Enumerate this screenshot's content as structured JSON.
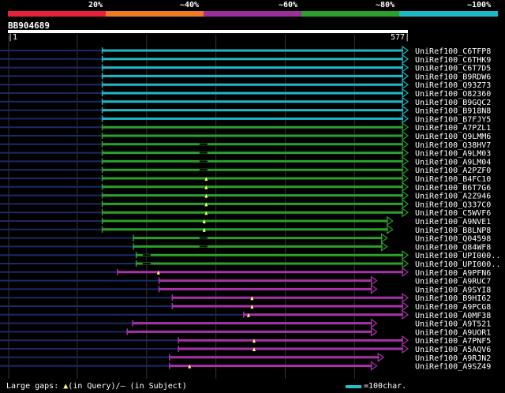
{
  "legend": {
    "labels": [
      "20%",
      "~40%",
      "~60%",
      "~80%",
      "~100%"
    ],
    "colors": [
      "#e8213a",
      "#ee7b24",
      "#9b309b",
      "#2ca02c",
      "#1fb8c6"
    ]
  },
  "query": {
    "name": "BB904689",
    "start": "1",
    "end": "577",
    "length": 577
  },
  "footer": {
    "gaps_prefix": "Large gaps:",
    "gaps_query": "(in Query)/",
    "gaps_subject": "— (in Subject)",
    "scale_label": "=100char."
  },
  "colors": {
    "cyan": "#1fb8c6",
    "green": "#2ca02c",
    "purple": "#a833a8",
    "navy": "#1a2a66",
    "gap": "#ffff66"
  },
  "hits": [
    {
      "name": "UniRef100_C6TFP8",
      "color": "cyan",
      "start": 136,
      "end": 577
    },
    {
      "name": "UniRef100_C6THK9",
      "color": "cyan",
      "start": 136,
      "end": 577
    },
    {
      "name": "UniRef100_C6T7D5",
      "color": "cyan",
      "start": 136,
      "end": 577
    },
    {
      "name": "UniRef100_B9RDW6",
      "color": "cyan",
      "start": 136,
      "end": 577
    },
    {
      "name": "UniRef100_Q93Z73",
      "color": "cyan",
      "start": 136,
      "end": 577
    },
    {
      "name": "UniRef100_O82360",
      "color": "cyan",
      "start": 136,
      "end": 577
    },
    {
      "name": "UniRef100_B9GQC2",
      "color": "cyan",
      "start": 136,
      "end": 577
    },
    {
      "name": "UniRef100_B918N8",
      "color": "cyan",
      "start": 136,
      "end": 577
    },
    {
      "name": "UniRef100_B7FJY5",
      "color": "cyan",
      "start": 136,
      "end": 577
    },
    {
      "name": "UniRef100_A7PZL1",
      "color": "green",
      "start": 136,
      "end": 577
    },
    {
      "name": "UniRef100_Q9LMM6",
      "color": "green",
      "start": 136,
      "end": 577
    },
    {
      "name": "UniRef100_Q38HV7",
      "color": "green",
      "start": 136,
      "end": 577,
      "gap": 282
    },
    {
      "name": "UniRef100_A9LM03",
      "color": "green",
      "start": 136,
      "end": 577,
      "gap": 282
    },
    {
      "name": "UniRef100_A9LM04",
      "color": "green",
      "start": 136,
      "end": 577,
      "gap": 282
    },
    {
      "name": "UniRef100_A2PZF0",
      "color": "green",
      "start": 136,
      "end": 577,
      "gap": 282
    },
    {
      "name": "UniRef100_B4FC10",
      "color": "green",
      "start": 136,
      "end": 577,
      "tri": 286
    },
    {
      "name": "UniRef100_B6T7G6",
      "color": "green",
      "start": 136,
      "end": 577,
      "tri": 286
    },
    {
      "name": "UniRef100_A2Z946",
      "color": "green",
      "start": 136,
      "end": 577,
      "tri": 286
    },
    {
      "name": "UniRef100_Q337C0",
      "color": "green",
      "start": 136,
      "end": 577,
      "tri": 286
    },
    {
      "name": "UniRef100_C5WVF6",
      "color": "green",
      "start": 136,
      "end": 577,
      "tri": 286
    },
    {
      "name": "UniRef100_A9NVE1",
      "color": "green",
      "start": 136,
      "end": 555,
      "tri": 283
    },
    {
      "name": "UniRef100_B8LNP8",
      "color": "green",
      "start": 136,
      "end": 555,
      "tri": 283
    },
    {
      "name": "UniRef100_Q04598",
      "color": "green",
      "start": 181,
      "end": 547,
      "gap": 282
    },
    {
      "name": "UniRef100_Q84WF8",
      "color": "green",
      "start": 181,
      "end": 547,
      "gap": 282
    },
    {
      "name": "UniRef100_UPI000..",
      "color": "green",
      "start": 185,
      "end": 577,
      "gap": 200
    },
    {
      "name": "UniRef100_UPI000..",
      "color": "green",
      "start": 185,
      "end": 577,
      "gap": 200
    },
    {
      "name": "UniRef100_A9PFN6",
      "color": "purple",
      "start": 158,
      "end": 577,
      "tri": 217
    },
    {
      "name": "UniRef100_A9RUC7",
      "color": "purple",
      "start": 218,
      "end": 532
    },
    {
      "name": "UniRef100_A9SYI8",
      "color": "purple",
      "start": 218,
      "end": 532
    },
    {
      "name": "UniRef100_B9HI62",
      "color": "purple",
      "start": 237,
      "end": 577,
      "tri": 352
    },
    {
      "name": "UniRef100_A9PCG8",
      "color": "purple",
      "start": 237,
      "end": 577,
      "tri": 352
    },
    {
      "name": "UniRef100_A0MF38",
      "color": "purple",
      "start": 340,
      "end": 577,
      "tri": 347
    },
    {
      "name": "UniRef100_A9T521",
      "color": "purple",
      "start": 180,
      "end": 532
    },
    {
      "name": "UniRef100_A9UOR1",
      "color": "purple",
      "start": 172,
      "end": 532
    },
    {
      "name": "UniRef100_A7PNF5",
      "color": "purple",
      "start": 246,
      "end": 577,
      "tri": 355
    },
    {
      "name": "UniRef100_A5AQV6",
      "color": "purple",
      "start": 246,
      "end": 577,
      "tri": 355
    },
    {
      "name": "UniRef100_A9RJN2",
      "color": "purple",
      "start": 233,
      "end": 542
    },
    {
      "name": "UniRef100_A9SZ49",
      "color": "purple",
      "start": 233,
      "end": 532,
      "tri": 262
    }
  ]
}
